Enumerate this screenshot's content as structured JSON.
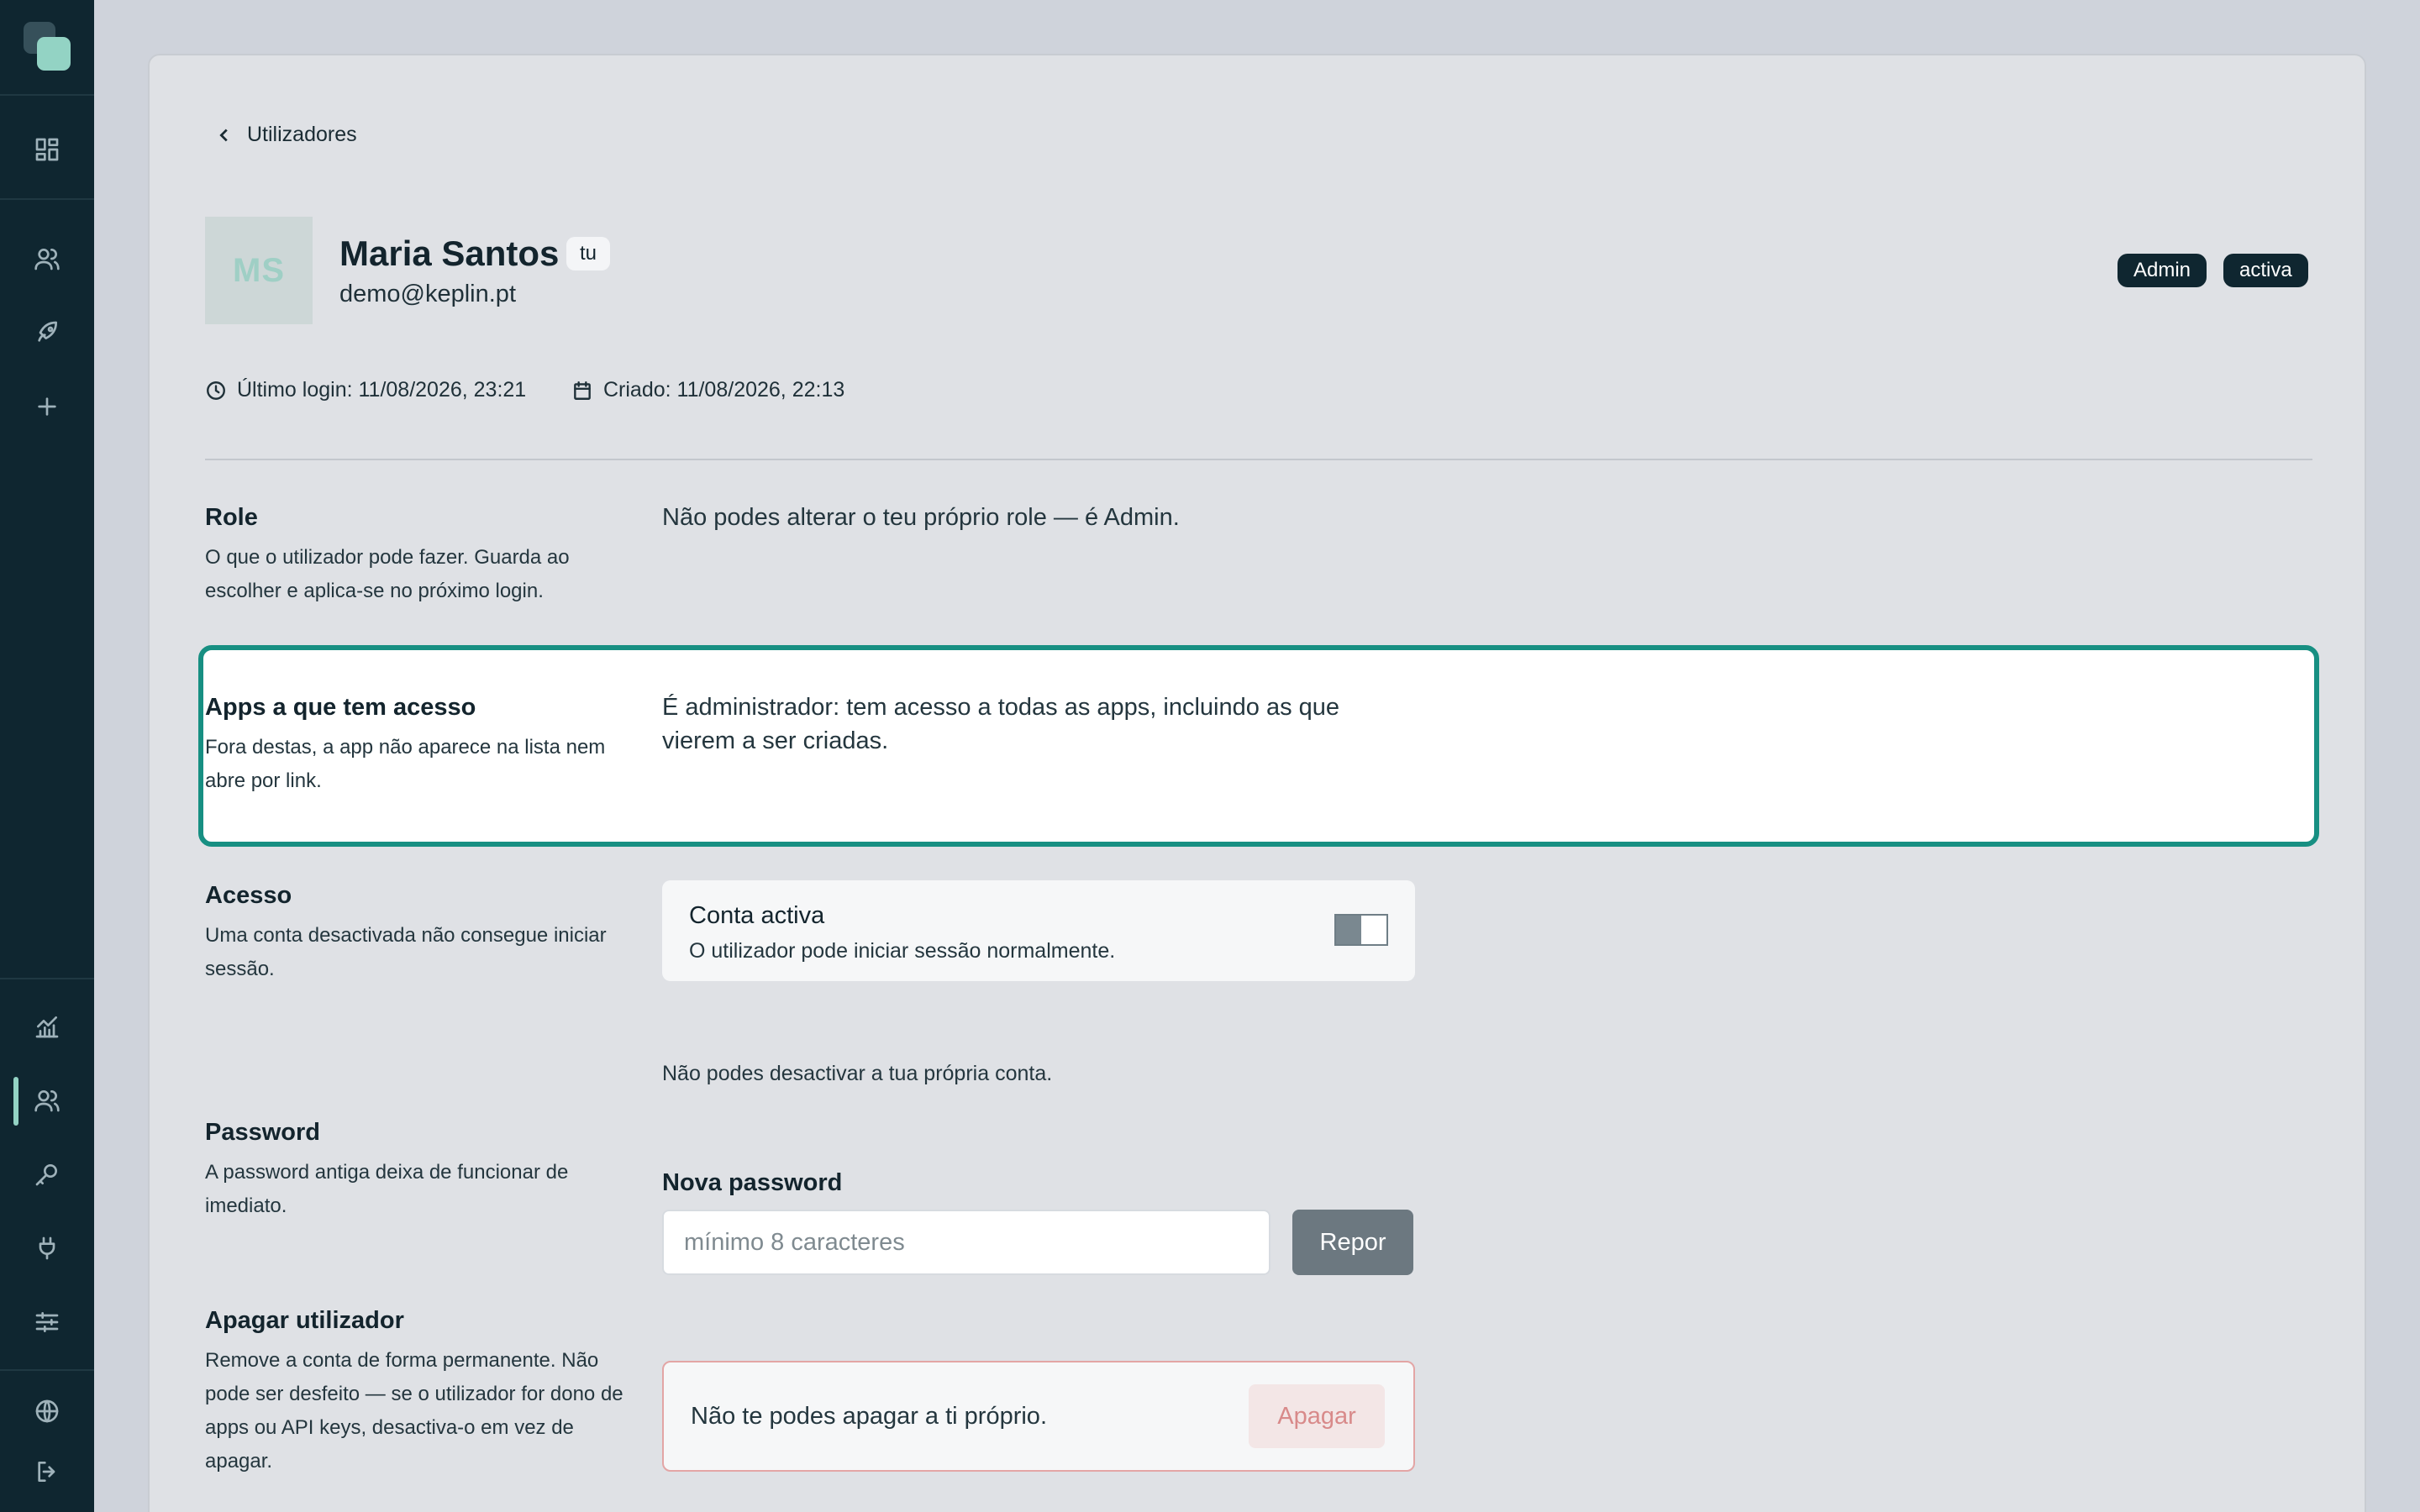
{
  "sidebar": {
    "top_icons": [
      "dashboard-icon",
      "users-icon",
      "rocket-icon",
      "plus-icon"
    ],
    "bottom_icons": [
      "analytics-icon",
      "users-icon",
      "key-icon",
      "plug-icon",
      "sliders-icon"
    ],
    "footer_icons": [
      "globe-icon",
      "logout-icon"
    ],
    "active_item": "users-icon",
    "colors": {
      "background": "#0f2630",
      "accent": "#93d3c4"
    }
  },
  "header": {
    "back_label": "Utilizadores"
  },
  "user": {
    "initials": "MS",
    "name": "Maria Santos",
    "you_badge": "tu",
    "email": "demo@keplin.pt",
    "role_badge": "Admin",
    "status_badge": "activa",
    "last_login": "Último login: 11/08/2026, 23:21",
    "created": "Criado: 11/08/2026, 22:13"
  },
  "sections": {
    "role": {
      "title": "Role",
      "description": "O que o utilizador pode fazer. Guarda ao escolher e aplica-se no próximo login.",
      "content": "Não podes alterar o teu próprio role — é Admin."
    },
    "apps": {
      "title": "Apps a que tem acesso",
      "description": "Fora destas, a app não aparece na lista nem abre por link.",
      "content": "É administrador: tem acesso a todas as apps, incluindo as que vierem a ser criadas."
    },
    "access": {
      "title": "Acesso",
      "description": "Uma conta desactivada não consegue iniciar sessão.",
      "toggle_title": "Conta activa",
      "toggle_subtitle": "O utilizador pode iniciar sessão normalmente.",
      "note": "Não podes desactivar a tua própria conta."
    },
    "password": {
      "title": "Password",
      "description": "A password antiga deixa de funcionar de imediato.",
      "field_label": "Nova password",
      "placeholder": "mínimo 8 caracteres",
      "value": "",
      "button": "Repor"
    },
    "delete": {
      "title": "Apagar utilizador",
      "description": "Remove a conta de forma permanente. Não pode ser desfeito — se o utilizador for dono de apps ou API keys, desactiva-o em vez de apagar.",
      "message": "Não te podes apagar a ti próprio.",
      "button": "Apagar"
    }
  },
  "colors": {
    "highlight_border": "#178f82",
    "danger_border": "#e3a5a5",
    "danger_text": "#d88a8a",
    "pill_bg": "#0f2630"
  }
}
